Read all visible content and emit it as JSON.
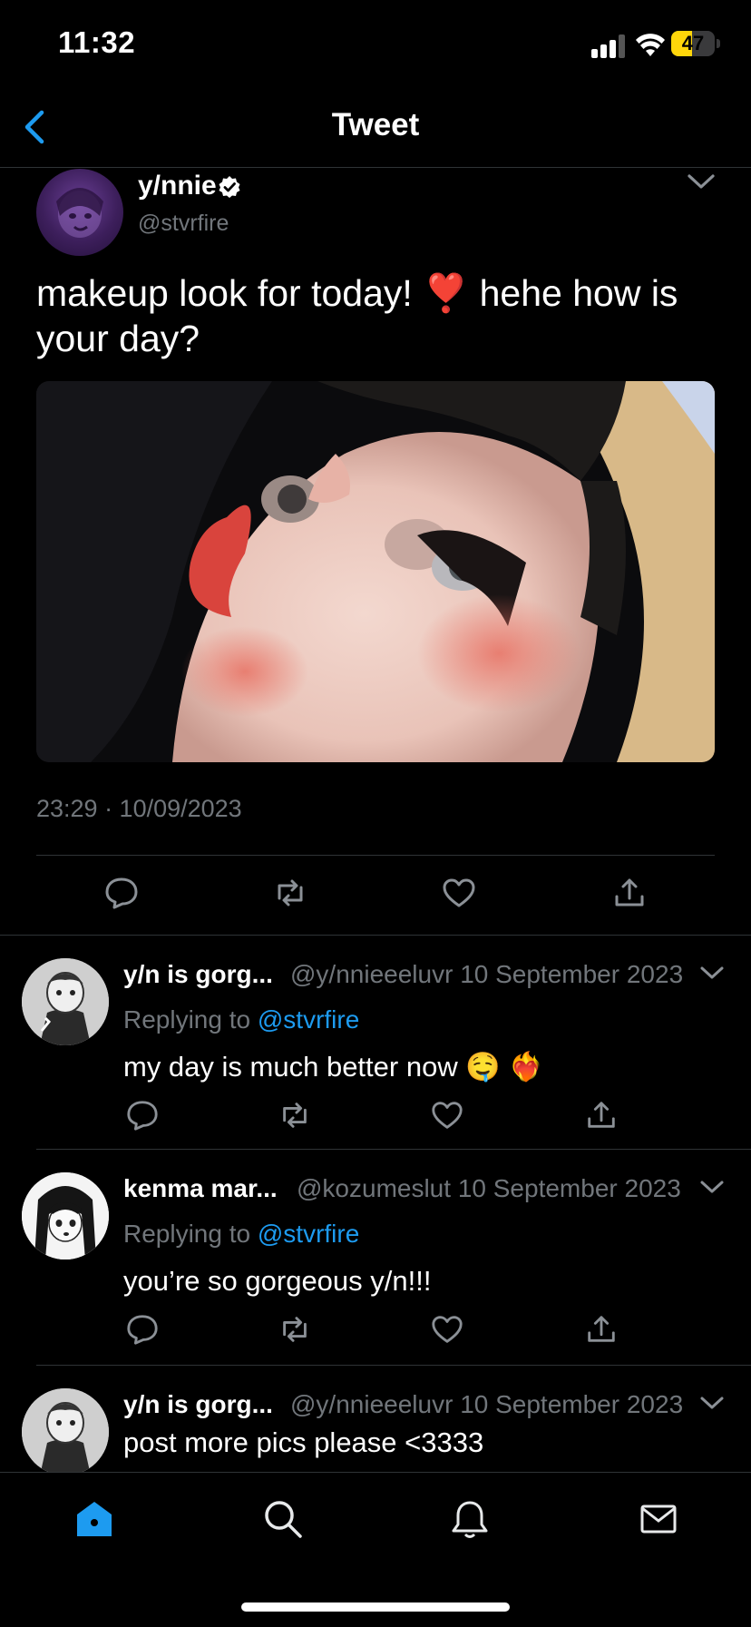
{
  "status_bar": {
    "time": "11:32",
    "battery": "47",
    "battery_level": 0.47
  },
  "header": {
    "title": "Tweet"
  },
  "tweet": {
    "display_name": "y/nnie",
    "handle": "@stvrfire",
    "text": "makeup look for today! ❣️ hehe how is your day?",
    "timestamp": "23:29 · 10/09/2023",
    "image_alt": "makeup-selfie"
  },
  "replies": [
    {
      "name": "y/n is gorg...",
      "handle": "@y/nnieeeluvr",
      "date": "10 September 2023",
      "replying_prefix": "Replying to ",
      "replying_to": "@stvrfire",
      "text": "my day is much better now 🤤 ❤️‍🔥"
    },
    {
      "name": "kenma mar...",
      "handle": "@kozumeslut",
      "date": "10 September 2023",
      "replying_prefix": "Replying to ",
      "replying_to": "@stvrfire",
      "text": "you’re so gorgeous y/n!!!"
    },
    {
      "name": "y/n is gorg...",
      "handle": "@y/nnieeeluvr",
      "date": "10 September 2023",
      "text": "post more pics please <3333"
    }
  ],
  "colors": {
    "accent": "#1d9bf0",
    "muted": "#71767b",
    "divider": "#2f3336",
    "background": "#000000"
  },
  "icons": [
    "back-chevron-icon",
    "verified-badge-icon",
    "chevron-down-icon",
    "reply-icon",
    "retweet-icon",
    "like-icon",
    "share-icon",
    "home-icon",
    "search-icon",
    "notifications-icon",
    "messages-icon"
  ]
}
